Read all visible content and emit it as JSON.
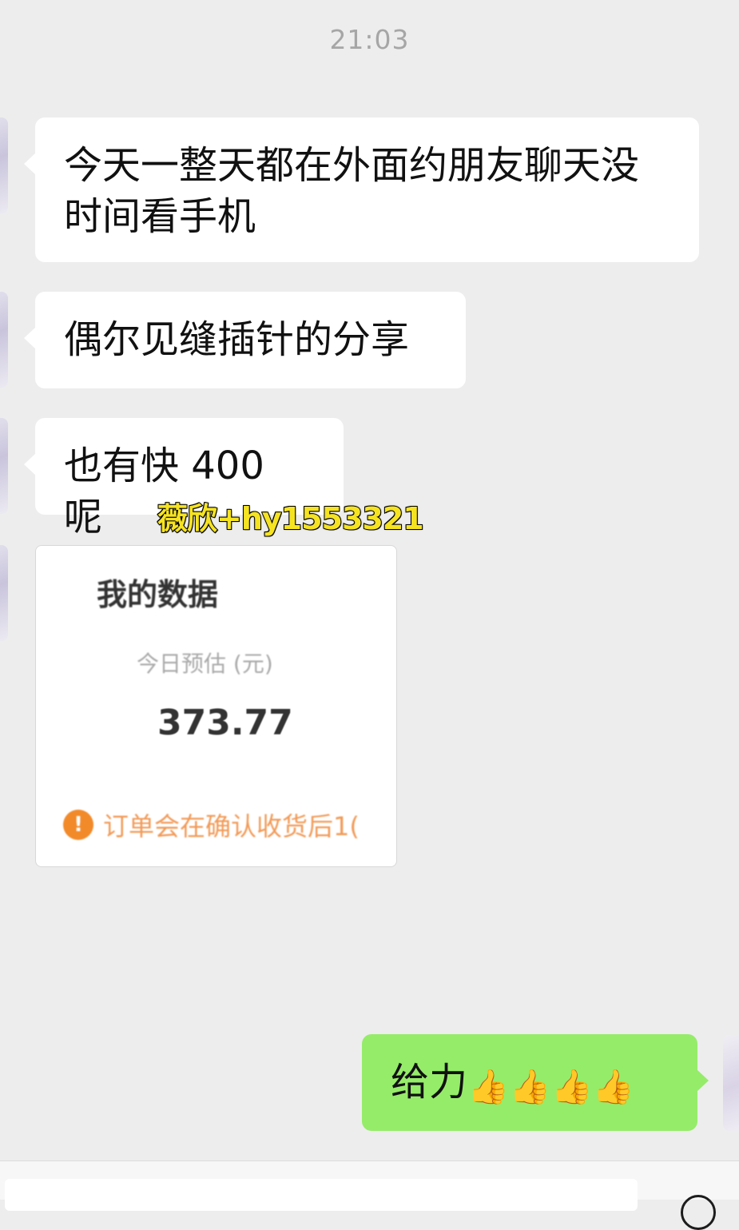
{
  "chat": {
    "timestamp": "21:03",
    "messages": [
      {
        "from": "other",
        "text": "今天一整天都在外面约朋友聊天没时间看手机"
      },
      {
        "from": "other",
        "text": "偶尔见缝插针的分享"
      },
      {
        "from": "other",
        "text": "也有快 400 呢"
      },
      {
        "from": "self",
        "text": "给力",
        "emoji": "👍👍👍👍"
      }
    ]
  },
  "watermark": "薇欣+hy1553321",
  "screenshot_card": {
    "title": "我的数据",
    "label": "今日预估 (元)",
    "value": "373.77",
    "notice": "订单会在确认收货后1(",
    "notice_icon": "exclamation-icon"
  },
  "colors": {
    "background": "#ededed",
    "bubble_other": "#ffffff",
    "bubble_self": "#95ec69",
    "watermark": "#f5e322"
  }
}
